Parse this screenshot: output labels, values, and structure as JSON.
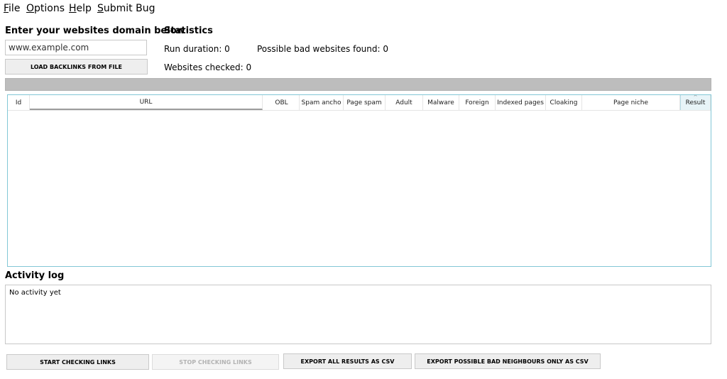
{
  "menu": {
    "items": [
      {
        "mnemonic": "F",
        "rest": "ile"
      },
      {
        "mnemonic": "O",
        "rest": "ptions"
      },
      {
        "mnemonic": "H",
        "rest": "elp"
      },
      {
        "mnemonic": "S",
        "rest": "ubmit Bug"
      }
    ]
  },
  "domain": {
    "heading": "Enter your websites domain below",
    "input_value": "www.example.com",
    "load_button": "LOAD BACKLINKS FROM FILE"
  },
  "statistics": {
    "heading": "Statistics",
    "run_duration": "Run duration: 0",
    "bad_found": "Possible bad websites found: 0",
    "checked": "Websites checked: 0"
  },
  "progress": {
    "value": 0
  },
  "table": {
    "columns": [
      "Id",
      "URL",
      "OBL",
      "Spam ancho",
      "Page spam",
      "Adult",
      "Malware",
      "Foreign",
      "Indexed pages",
      "Cloaking",
      "Page niche",
      "Result"
    ],
    "rows": []
  },
  "activity": {
    "heading": "Activity log",
    "text": "No activity yet"
  },
  "actions": {
    "start": "START CHECKING LINKS",
    "stop": "STOP CHECKING LINKS",
    "export_all": "EXPORT ALL RESULTS AS CSV",
    "export_bad": "EXPORT POSSIBLE BAD NEIGHBOURS ONLY AS CSV"
  }
}
